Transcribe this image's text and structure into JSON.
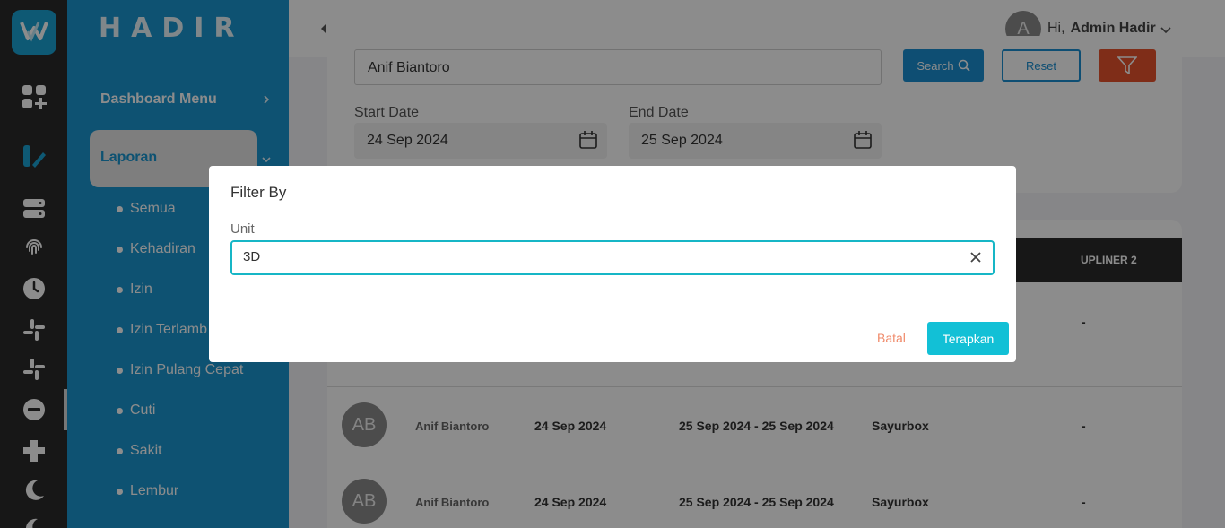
{
  "app": {
    "brand": "HADIR"
  },
  "rail": {
    "icons": [
      "logo-icon",
      "dashboard-add-icon",
      "report-icon",
      "server-icon",
      "fingerprint-icon",
      "clock-icon",
      "slack-icon",
      "slack-icon-2",
      "minus-circle-icon",
      "plus-icon",
      "moon-icon"
    ]
  },
  "sidebar": {
    "dashboard_menu": "Dashboard Menu",
    "laporan": "Laporan",
    "items": [
      {
        "label": "Semua"
      },
      {
        "label": "Kehadiran"
      },
      {
        "label": "Izin"
      },
      {
        "label": "Izin Terlamb"
      },
      {
        "label": "Izin Pulang Cepat"
      },
      {
        "label": "Cuti"
      },
      {
        "label": "Sakit"
      },
      {
        "label": "Lembur"
      }
    ]
  },
  "header": {
    "avatar_initial": "A",
    "greeting": "Hi,",
    "user_name": "Admin Hadir"
  },
  "filters": {
    "search_value": "Anif Biantoro",
    "search_label": "Search",
    "reset_label": "Reset",
    "start_label": "Start Date",
    "start_value": "24 Sep 2024",
    "end_label": "End Date",
    "end_value": "25 Sep 2024"
  },
  "table": {
    "upliner_header": "UPLINER 2",
    "rows": [
      {
        "avatar": "",
        "name": "",
        "date": "",
        "range": "",
        "unit": "",
        "upliner": "-"
      },
      {
        "avatar": "AB",
        "name": "Anif Biantoro",
        "date": "24 Sep 2024",
        "range": "25 Sep 2024 - 25 Sep 2024",
        "unit": "Sayurbox",
        "upliner": "-"
      },
      {
        "avatar": "AB",
        "name": "Anif Biantoro",
        "date": "24 Sep 2024",
        "range": "25 Sep 2024 - 25 Sep 2024",
        "unit": "Sayurbox",
        "upliner": "-"
      }
    ]
  },
  "modal": {
    "title": "Filter By",
    "unit_label": "Unit",
    "unit_value": "3D",
    "cancel_label": "Batal",
    "apply_label": "Terapkan"
  },
  "colors": {
    "sidebar": "#1a96cf",
    "rail": "#2b2b2b",
    "accent_cyan": "#12c0d6",
    "filter_orange": "#e8532c",
    "cancel_text": "#f08a6a"
  }
}
